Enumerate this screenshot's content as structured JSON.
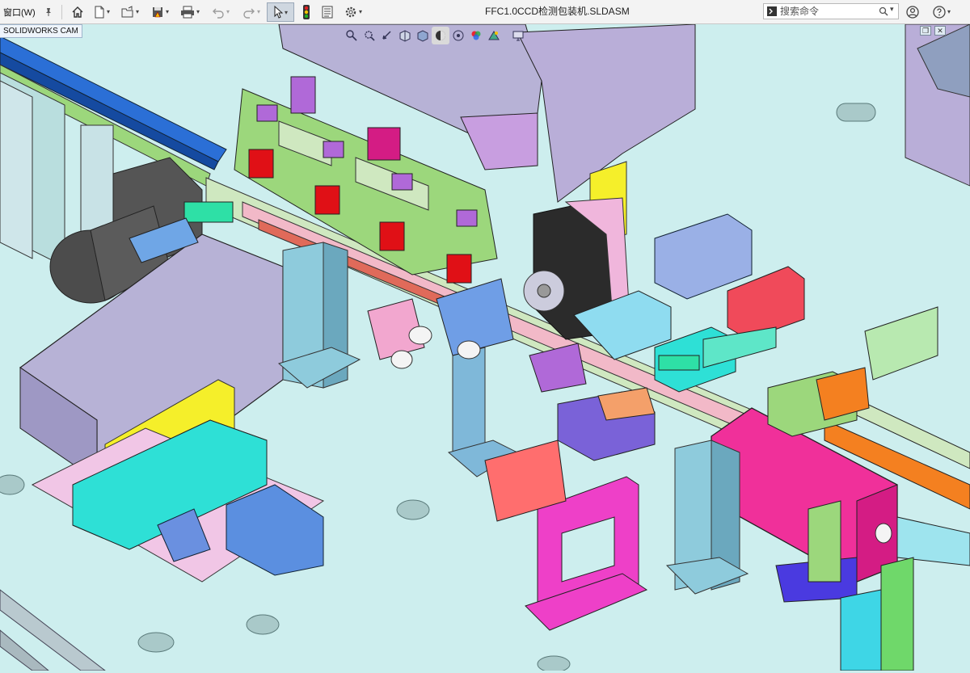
{
  "toolbar": {
    "window_menu": "窗口(W)",
    "document_title": "FFC1.0CCD检测包装机.SLDASM",
    "search_placeholder": "搜索命令",
    "icons": [
      "pin-icon",
      "home-icon",
      "new-document-icon",
      "open-folder-icon",
      "save-icon",
      "print-icon",
      "undo-icon",
      "redo-icon",
      "select-arrow-icon",
      "traffic-light-icon",
      "file-properties-icon",
      "options-gear-icon",
      "search-icon",
      "user-account-icon",
      "help-icon"
    ]
  },
  "cam_tab": {
    "label": "SOLIDWORKS CAM"
  },
  "heads_up_toolbar": {
    "icons": [
      "zoom-to-fit-icon",
      "zoom-to-area-icon",
      "previous-view-icon",
      "section-view-icon",
      "view-orientation-icon",
      "display-style-icon",
      "hide-show-items-icon",
      "edit-appearance-icon",
      "apply-scene-icon",
      "view-settings-icon"
    ]
  },
  "viewport": {
    "content": "3D assembly model",
    "background": "#cdeeee",
    "colors": {
      "base_plate": "#cdeeee",
      "pink_guard": "#b7a6d2",
      "magenta_block": "#f0309a",
      "yellow_bracket": "#f5ef2a",
      "green_frame": "#9cd77c",
      "red_part": "#e01016",
      "blue_rail": "#2b6fd6",
      "gray_motor": "#4c4c4c"
    }
  }
}
